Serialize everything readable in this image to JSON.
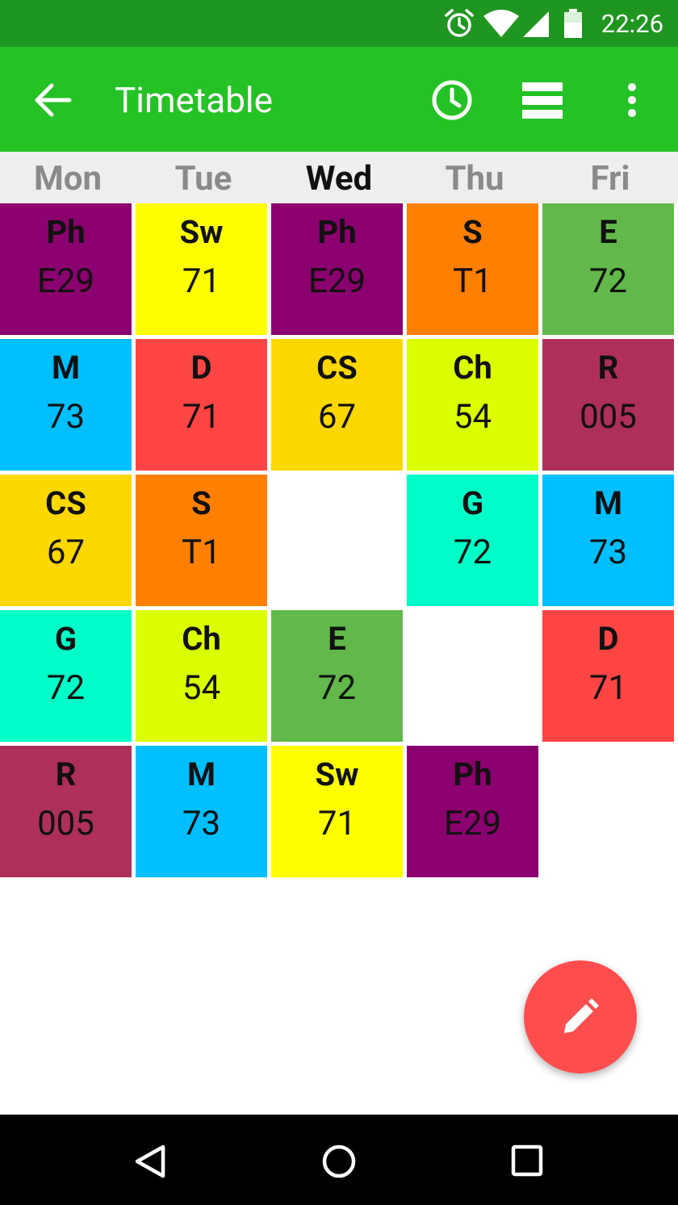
{
  "status_bar": {
    "time": "22:26",
    "icons": [
      "alarm-icon",
      "wifi-icon",
      "signal-icon",
      "battery-icon"
    ]
  },
  "app_bar": {
    "title": "Timetable",
    "background": "#24c224",
    "icons": [
      "back-arrow-icon",
      "clock-icon",
      "list-view-icon",
      "more-options-icon"
    ]
  },
  "days": [
    {
      "label": "Mon",
      "current": false
    },
    {
      "label": "Tue",
      "current": false
    },
    {
      "label": "Wed",
      "current": true
    },
    {
      "label": "Thu",
      "current": false
    },
    {
      "label": "Fri",
      "current": false
    }
  ],
  "timetable": [
    [
      {
        "subject": "Ph",
        "room": "E29",
        "color": "#8b006e"
      },
      {
        "subject": "M",
        "room": "73",
        "color": "#00bfff"
      },
      {
        "subject": "CS",
        "room": "67",
        "color": "#ffd700"
      },
      {
        "subject": "G",
        "room": "72",
        "color": "#00ffc8"
      },
      {
        "subject": "R",
        "room": "005",
        "color": "#ad2f5a"
      }
    ],
    [
      {
        "subject": "Sw",
        "room": "71",
        "color": "#ffff00"
      },
      {
        "subject": "D",
        "room": "71",
        "color": "#ff4444"
      },
      {
        "subject": "S",
        "room": "T1",
        "color": "#ff8000"
      },
      {
        "subject": "Ch",
        "room": "54",
        "color": "#dcff00"
      },
      {
        "subject": "M",
        "room": "73",
        "color": "#00bfff"
      }
    ],
    [
      {
        "subject": "Ph",
        "room": "E29",
        "color": "#8b006e"
      },
      {
        "subject": "CS",
        "room": "67",
        "color": "#ffd700"
      },
      null,
      {
        "subject": "E",
        "room": "72",
        "color": "#62b84a"
      },
      {
        "subject": "Sw",
        "room": "71",
        "color": "#ffff00"
      }
    ],
    [
      {
        "subject": "S",
        "room": "T1",
        "color": "#ff8000"
      },
      {
        "subject": "Ch",
        "room": "54",
        "color": "#dcff00"
      },
      {
        "subject": "G",
        "room": "72",
        "color": "#00ffc8"
      },
      null,
      {
        "subject": "Ph",
        "room": "E29",
        "color": "#8b006e"
      }
    ],
    [
      {
        "subject": "E",
        "room": "72",
        "color": "#62b84a"
      },
      {
        "subject": "R",
        "room": "005",
        "color": "#ad2f5a"
      },
      {
        "subject": "M",
        "room": "73",
        "color": "#00bfff"
      },
      {
        "subject": "D",
        "room": "71",
        "color": "#ff4444"
      },
      null
    ]
  ],
  "fab": {
    "icon": "edit-pencil-icon",
    "color": "#ff4d4d"
  },
  "navigation_bar": {
    "icons": [
      "back-triangle-icon",
      "home-circle-icon",
      "recents-square-icon"
    ]
  }
}
